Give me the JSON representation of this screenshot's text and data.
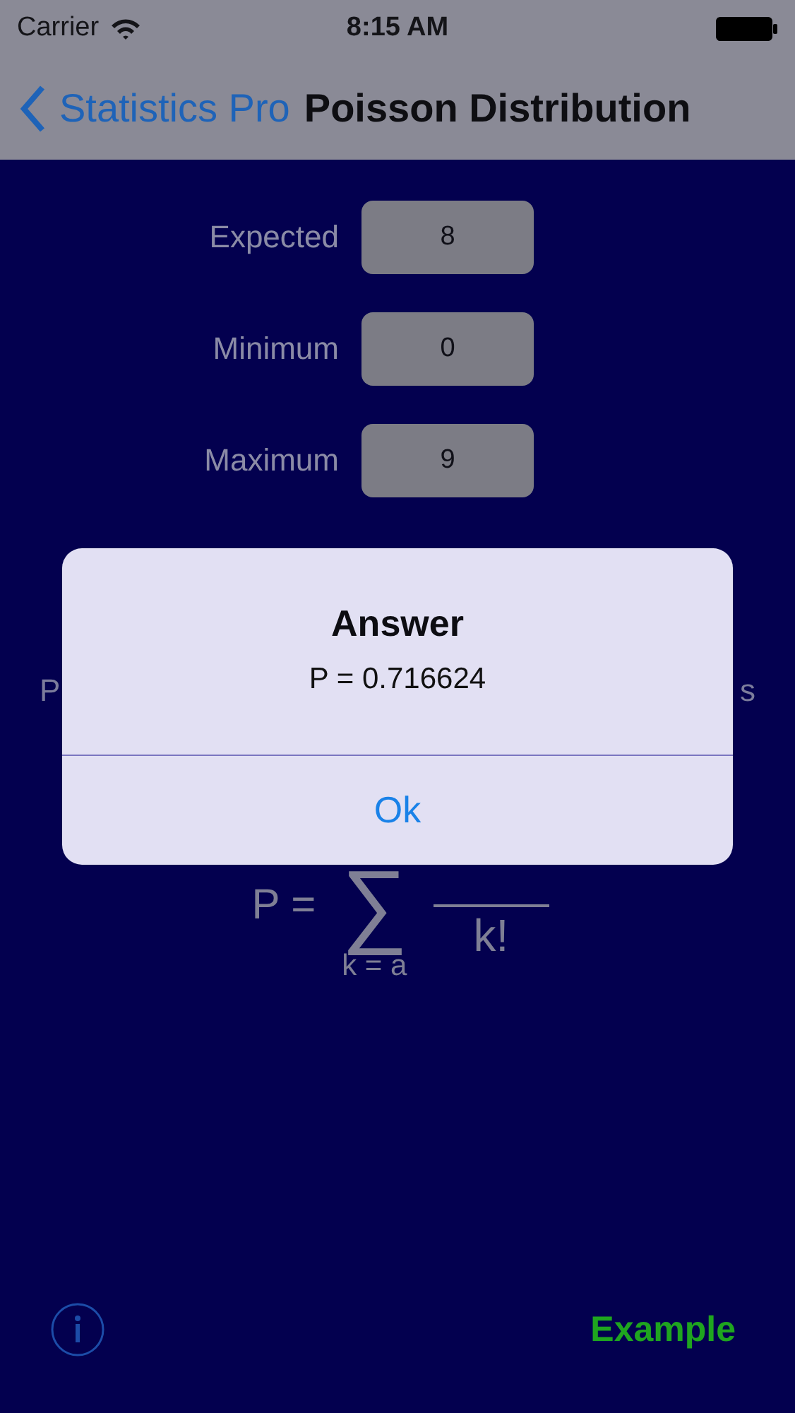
{
  "status_bar": {
    "carrier": "Carrier",
    "time": "8:15 AM"
  },
  "nav_bar": {
    "back_label": "Statistics Pro",
    "title": "Poisson Distribution"
  },
  "fields": [
    {
      "label": "Expected",
      "value": "8"
    },
    {
      "label": "Minimum",
      "value": "0"
    },
    {
      "label": "Maximum",
      "value": "9"
    }
  ],
  "description": {
    "left_fragment": "P",
    "right_fragment": "s"
  },
  "formula": {
    "lhs": "P =",
    "symbol": "∑",
    "denominator": "k!",
    "lower_limit": "k = a"
  },
  "alert": {
    "title": "Answer",
    "message": "P = 0.716624",
    "button": "Ok"
  },
  "footer": {
    "button": "Example"
  }
}
